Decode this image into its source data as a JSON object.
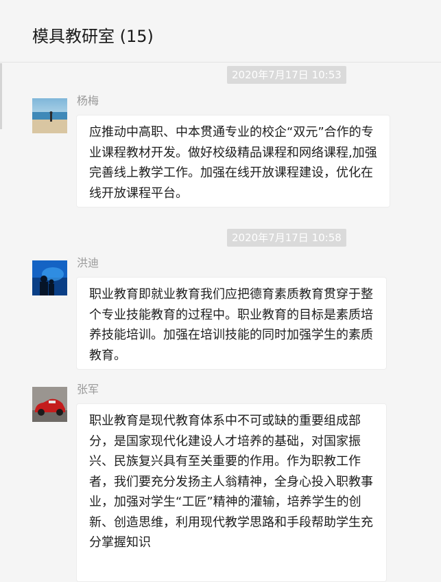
{
  "header": {
    "title": "模具教研室 (15)"
  },
  "messages": [
    {
      "timestamp": "2020年7月17日 10:53",
      "sender": "杨梅",
      "text": "应推动中高职、中本贯通专业的校企“双元”合作的专业课程教材开发。做好校级精品课程和网络课程,加强完善线上教学工作。加强在线开放课程建设，优化在线开放课程平台。"
    },
    {
      "timestamp": "2020年7月17日 10:58",
      "sender": "洪迪",
      "text": "职业教育即就业教育我们应把德育素质教育贯穿于整个专业技能教育的过程中。职业教育的目标是素质培养技能培训。加强在培训技能的同时加强学生的素质教育。"
    },
    {
      "sender": "张军",
      "text": "职业教育是现代教育体系中不可或缺的重要组成部分，是国家现代化建设人才培养的基础，对国家振兴、民族复兴具有至关重要的作用。作为职教工作者，我们要充分发扬主人翁精神，全身心投入职教事业，加强对学生“工匠”精神的灌输，培养学生的创新、创造思维，利用现代教学思路和手段帮助学生充分掌握知识"
    }
  ]
}
